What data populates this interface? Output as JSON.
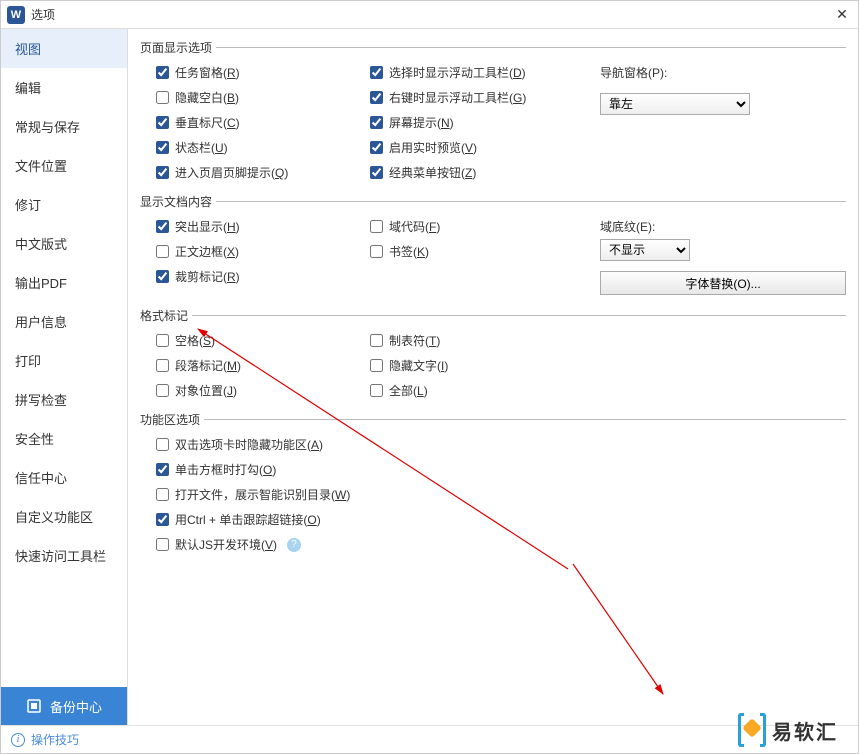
{
  "title": "选项",
  "sidebar": {
    "items": [
      {
        "label": "视图"
      },
      {
        "label": "编辑"
      },
      {
        "label": "常规与保存"
      },
      {
        "label": "文件位置"
      },
      {
        "label": "修订"
      },
      {
        "label": "中文版式"
      },
      {
        "label": "输出PDF"
      },
      {
        "label": "用户信息"
      },
      {
        "label": "打印"
      },
      {
        "label": "拼写检查"
      },
      {
        "label": "安全性"
      },
      {
        "label": "信任中心"
      },
      {
        "label": "自定义功能区"
      },
      {
        "label": "快速访问工具栏"
      }
    ],
    "backup": "备份中心"
  },
  "groups": {
    "pageDisplay": {
      "legend": "页面显示选项",
      "col1": [
        {
          "label": "任务窗格(R)",
          "checked": true
        },
        {
          "label": "隐藏空白(B)",
          "checked": false
        },
        {
          "label": "垂直标尺(C)",
          "checked": true
        },
        {
          "label": "状态栏(U)",
          "checked": true
        },
        {
          "label": "进入页眉页脚提示(Q)",
          "checked": true
        }
      ],
      "col2": [
        {
          "label": "选择时显示浮动工具栏(D)",
          "checked": true
        },
        {
          "label": "右键时显示浮动工具栏(G)",
          "checked": true
        },
        {
          "label": "屏幕提示(N)",
          "checked": true
        },
        {
          "label": "启用实时预览(V)",
          "checked": true
        },
        {
          "label": "经典菜单按钮(Z)",
          "checked": true
        }
      ],
      "navLabel": "导航窗格(P):",
      "navValue": "靠左"
    },
    "docContent": {
      "legend": "显示文档内容",
      "col1": [
        {
          "label": "突出显示(H)",
          "checked": true
        },
        {
          "label": "正文边框(X)",
          "checked": false
        },
        {
          "label": "裁剪标记(R)",
          "checked": true
        }
      ],
      "col2": [
        {
          "label": "域代码(F)",
          "checked": false
        },
        {
          "label": "书签(K)",
          "checked": false
        }
      ],
      "shadeLabel": "域底纹(E):",
      "shadeValue": "不显示",
      "fontSubBtn": "字体替换(O)..."
    },
    "formatMarks": {
      "legend": "格式标记",
      "col1": [
        {
          "label": "空格(S)",
          "checked": false
        },
        {
          "label": "段落标记(M)",
          "checked": false
        },
        {
          "label": "对象位置(J)",
          "checked": false
        }
      ],
      "col2": [
        {
          "label": "制表符(T)",
          "checked": false
        },
        {
          "label": "隐藏文字(I)",
          "checked": false
        },
        {
          "label": "全部(L)",
          "checked": false
        }
      ]
    },
    "funcOptions": {
      "legend": "功能区选项",
      "items": [
        {
          "label": "双击选项卡时隐藏功能区(A)",
          "checked": false
        },
        {
          "label": "单击方框时打勾(O)",
          "checked": true
        },
        {
          "label": "打开文件，展示智能识别目录(W)",
          "checked": false
        },
        {
          "label": "用Ctrl + 单击跟踪超链接(O)",
          "checked": true
        },
        {
          "label": "默认JS开发环境(V)",
          "checked": false,
          "help": true
        }
      ]
    }
  },
  "footer": {
    "tips": "操作技巧"
  },
  "watermark": "易软汇",
  "wIconLetter": "W"
}
